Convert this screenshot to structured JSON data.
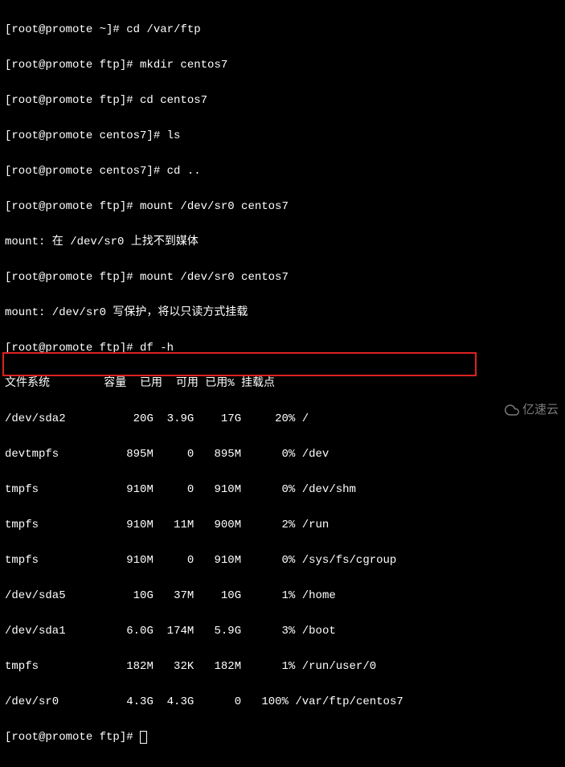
{
  "lines": {
    "l0": "[root@promote ~]# cd /var/ftp",
    "l1": "[root@promote ftp]# mkdir centos7",
    "l2": "[root@promote ftp]# cd centos7",
    "l3": "[root@promote centos7]# ls",
    "l4": "[root@promote centos7]# cd ..",
    "l5": "[root@promote ftp]# mount /dev/sr0 centos7",
    "l6": "mount: 在 /dev/sr0 上找不到媒体",
    "l7": "[root@promote ftp]# mount /dev/sr0 centos7",
    "l8": "mount: /dev/sr0 写保护，将以只读方式挂载",
    "l9": "[root@promote ftp]# df -h",
    "h0": "文件系统",
    "h1": "容量",
    "h2": "已用",
    "h3": "可用",
    "h4": "已用%",
    "h5": "挂载点",
    "r0c0": "/dev/sda2",
    "r0c1": " 20G",
    "r0c2": "3.9G",
    "r0c3": " 17G",
    "r0c4": " 20%",
    "r0c5": "/",
    "r1c0": "devtmpfs",
    "r1c1": "895M",
    "r1c2": "   0",
    "r1c3": "895M",
    "r1c4": "  0%",
    "r1c5": "/dev",
    "r2c0": "tmpfs",
    "r2c1": "910M",
    "r2c2": "   0",
    "r2c3": "910M",
    "r2c4": "  0%",
    "r2c5": "/dev/shm",
    "r3c0": "tmpfs",
    "r3c1": "910M",
    "r3c2": " 11M",
    "r3c3": "900M",
    "r3c4": "  2%",
    "r3c5": "/run",
    "r4c0": "tmpfs",
    "r4c1": "910M",
    "r4c2": "   0",
    "r4c3": "910M",
    "r4c4": "  0%",
    "r4c5": "/sys/fs/cgroup",
    "r5c0": "/dev/sda5",
    "r5c1": " 10G",
    "r5c2": " 37M",
    "r5c3": " 10G",
    "r5c4": "  1%",
    "r5c5": "/home",
    "r6c0": "/dev/sda1",
    "r6c1": "6.0G",
    "r6c2": "174M",
    "r6c3": "5.9G",
    "r6c4": "  3%",
    "r6c5": "/boot",
    "r7c0": "tmpfs",
    "r7c1": "182M",
    "r7c2": " 32K",
    "r7c3": "182M",
    "r7c4": "  1%",
    "r7c5": "/run/user/0",
    "r8c0": "/dev/sr0",
    "r8c1": "4.3G",
    "r8c2": "4.3G",
    "r8c3": "   0",
    "r8c4": "100%",
    "r8c5": "/var/ftp/centos7",
    "prompt_last": "[root@promote ftp]# ",
    "watermark": "亿速云"
  }
}
